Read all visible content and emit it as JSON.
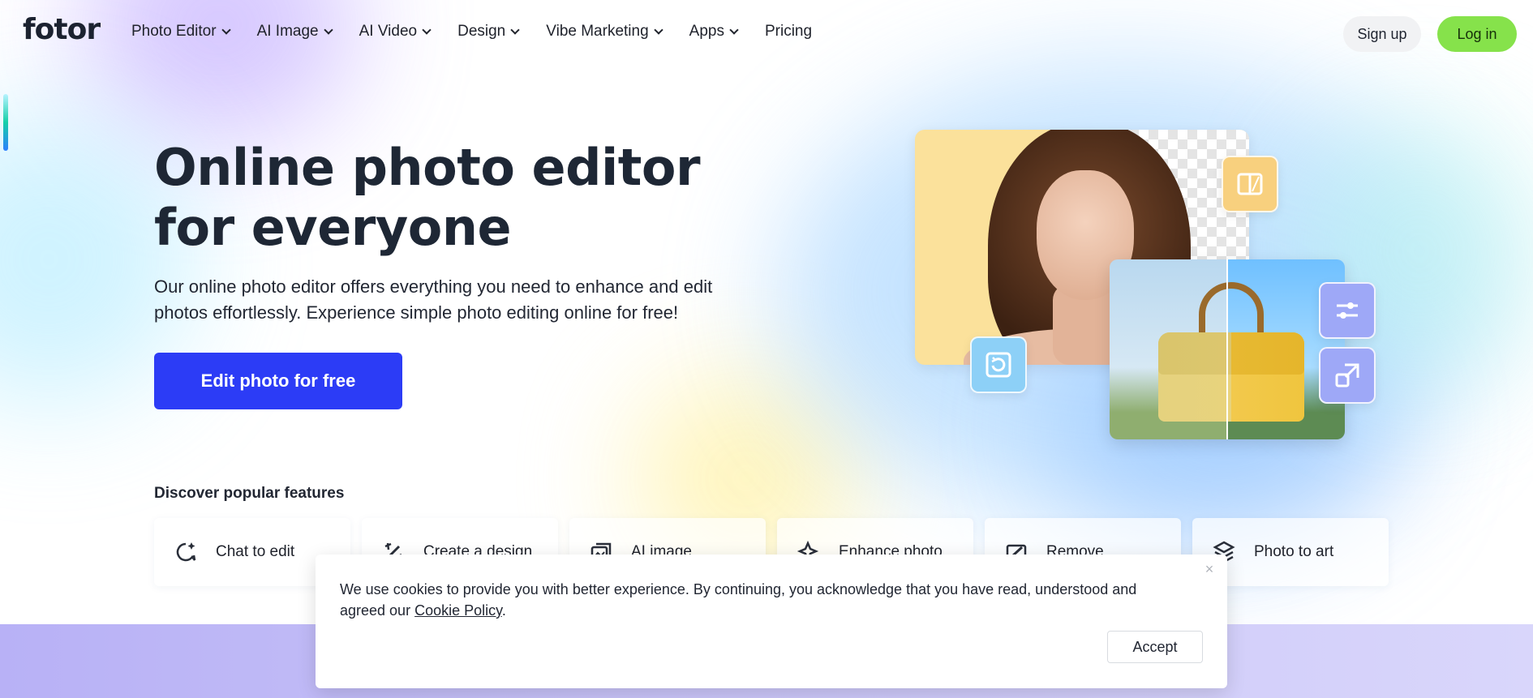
{
  "brand": {
    "logo_text": "fotor",
    "accent": "#2c3cf6",
    "login_green": "#86e24b"
  },
  "nav": {
    "items": [
      {
        "label": "Photo Editor",
        "has_dropdown": true
      },
      {
        "label": "AI Image",
        "has_dropdown": true
      },
      {
        "label": "AI Video",
        "has_dropdown": true
      },
      {
        "label": "Design",
        "has_dropdown": true
      },
      {
        "label": "Vibe Marketing",
        "has_dropdown": true
      },
      {
        "label": "Apps",
        "has_dropdown": true
      },
      {
        "label": "Pricing",
        "has_dropdown": false
      }
    ],
    "signup_label": "Sign up",
    "login_label": "Log in"
  },
  "hero": {
    "title": "Online photo editor for everyone",
    "subtitle": "Our online photo editor offers everything you need to enhance and edit photos effortlessly. Experience simple photo editing online for free!",
    "cta_label": "Edit photo for free",
    "tool_icons": [
      "compare-icon",
      "rotate-icon",
      "sliders-icon",
      "resize-icon"
    ]
  },
  "features": {
    "heading": "Discover popular features",
    "items": [
      {
        "label": "Chat to edit",
        "icon": "chat-sparkle-icon"
      },
      {
        "label": "Create a design",
        "icon": "design-tools-icon"
      },
      {
        "label": "AI image",
        "icon": "image-stack-icon"
      },
      {
        "label": "Enhance photo",
        "icon": "enhance-sparkle-icon"
      },
      {
        "label": "Remove",
        "icon": "remove-object-icon"
      },
      {
        "label": "Photo to art",
        "icon": "art-brush-icon"
      }
    ]
  },
  "cookie": {
    "text": "We use cookies to provide you with better experience. By continuing, you acknowledge that you have read, understood and agreed our",
    "link_label": "Cookie Policy",
    "suffix": ".",
    "close_symbol": "×",
    "accept_label": "Accept"
  }
}
